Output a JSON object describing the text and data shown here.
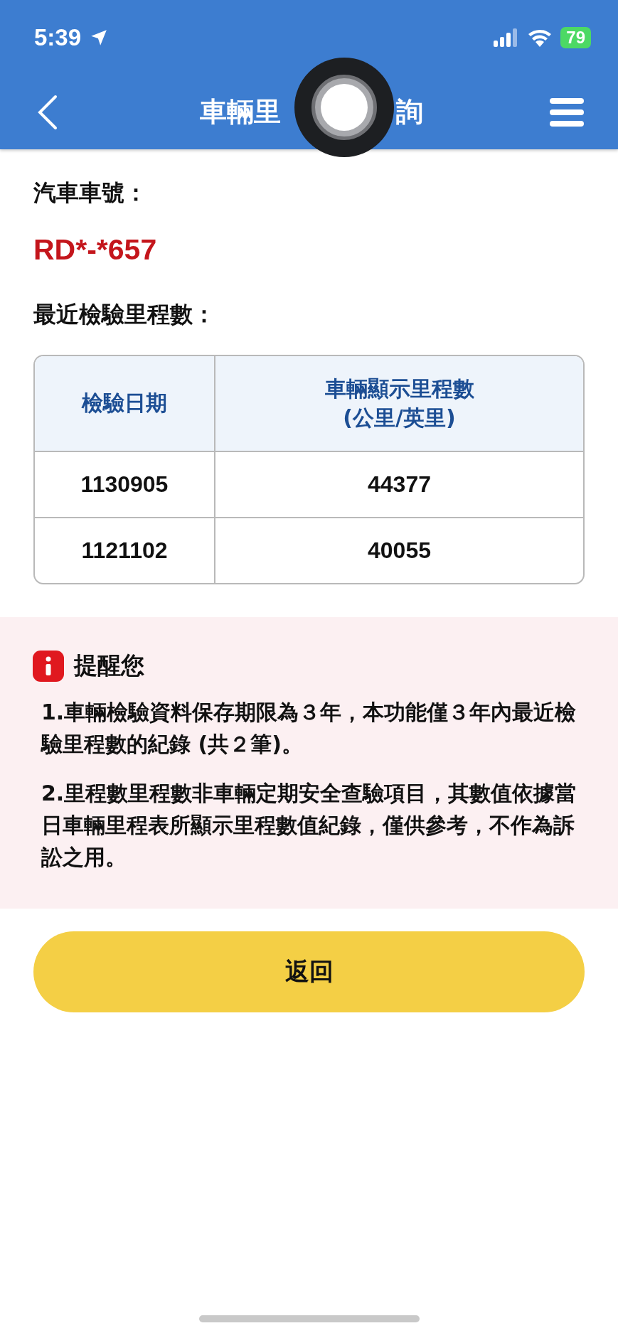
{
  "status_bar": {
    "time": "5:39",
    "battery": "79"
  },
  "nav": {
    "title_parts": [
      "車輛里",
      "詢"
    ]
  },
  "plate": {
    "label": "汽車車號：",
    "value": "RD*-*657"
  },
  "mileage": {
    "label": "最近檢驗里程數：",
    "columns": [
      "檢驗日期",
      "車輛顯示里程數\n(公里/英里)"
    ],
    "rows": [
      [
        "1130905",
        "44377"
      ],
      [
        "1121102",
        "40055"
      ]
    ]
  },
  "notice": {
    "title": "提醒您",
    "items": [
      "1.車輛檢驗資料保存期限為３年，本功能僅３年內最近檢驗里程數的紀錄 (共２筆)。",
      "2.里程數里程數非車輛定期安全查驗項目，其數值依據當日車輛里程表所顯示里程數值紀錄，僅供參考，不作為訴訟之用。"
    ]
  },
  "button": "返回"
}
